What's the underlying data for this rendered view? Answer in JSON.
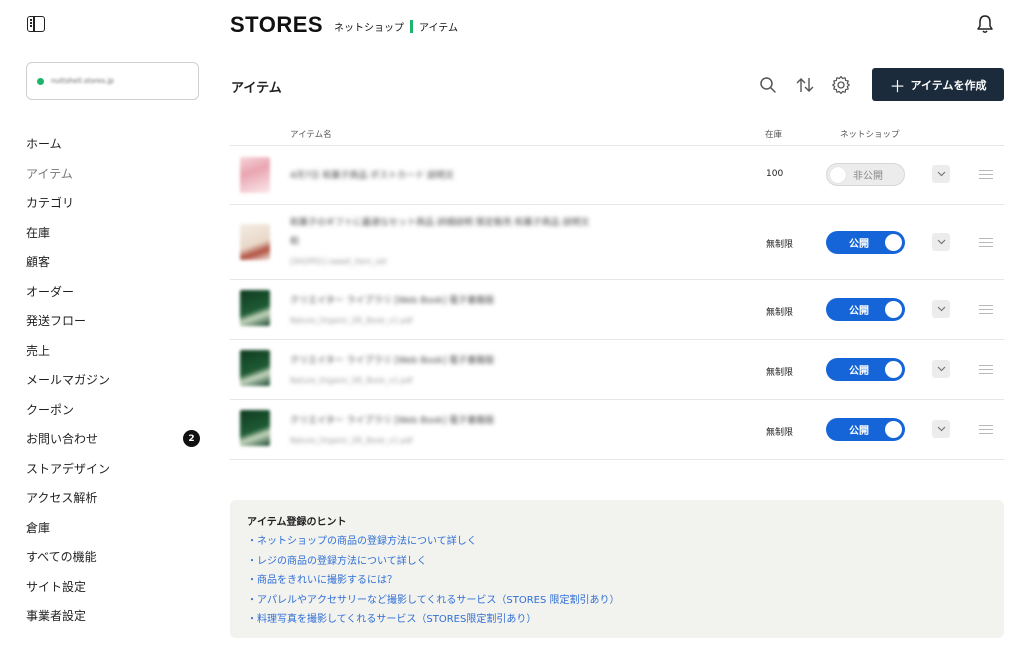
{
  "sidebar": {
    "store_url": "nuttshell.stores.jp",
    "items": [
      {
        "label": "ホーム"
      },
      {
        "label": "アイテム",
        "active": true
      },
      {
        "label": "カテゴリ"
      },
      {
        "label": "在庫"
      },
      {
        "label": "顧客"
      },
      {
        "label": "オーダー"
      },
      {
        "label": "発送フロー"
      },
      {
        "label": "売上"
      },
      {
        "label": "メールマガジン"
      },
      {
        "label": "クーポン"
      },
      {
        "label": "お問い合わせ",
        "badge": "2"
      },
      {
        "label": "ストアデザイン"
      },
      {
        "label": "アクセス解析"
      },
      {
        "label": "倉庫"
      },
      {
        "label": "すべての機能"
      },
      {
        "label": "サイト設定"
      },
      {
        "label": "事業者設定"
      }
    ]
  },
  "header": {
    "logo": "STORES",
    "section": "ネットショップ",
    "page": "アイテム"
  },
  "page": {
    "title": "アイテム",
    "create_button": "アイテムを作成"
  },
  "table": {
    "columns": {
      "name": "アイテム名",
      "stock": "在庫",
      "shop": "ネットショップ"
    },
    "rows": [
      {
        "title": "4月7日 和菓子商品 ポストカード 説明文",
        "subtitle": "",
        "stock": "100",
        "status": "非公開",
        "published": false,
        "thumb": "pink"
      },
      {
        "title": "和菓子のギフトに最適なセット商品 詳細説明 限定販売 和菓子商品 説明文",
        "title2": "和",
        "subtitle": "[SHOP01] sweet_item_set",
        "stock": "無制限",
        "status": "公開",
        "published": true,
        "thumb": "cream"
      },
      {
        "title": "クリエイター ライブラリ [Web Book] 電子書籍版",
        "subtitle": "Nature_Organic_DE_Book_v1.pdf",
        "stock": "無制限",
        "status": "公開",
        "published": true,
        "thumb": "green"
      },
      {
        "title": "クリエイター ライブラリ [Web Book] 電子書籍版",
        "subtitle": "Nature_Organic_DE_Book_v1.pdf",
        "stock": "無制限",
        "status": "公開",
        "published": true,
        "thumb": "green"
      },
      {
        "title": "クリエイター ライブラリ [Web Book] 電子書籍版",
        "subtitle": "Nature_Organic_DE_Book_v1.pdf",
        "stock": "無制限",
        "status": "公開",
        "published": true,
        "thumb": "green"
      }
    ]
  },
  "hints": {
    "title": "アイテム登録のヒント",
    "links": [
      "・ネットショップの商品の登録方法について詳しく",
      "・レジの商品の登録方法について詳しく",
      "・商品をきれいに撮影するには？",
      "・アパレルやアクセサリーなど撮影してくれるサービス（STORES 限定割引あり）",
      "・料理写真を撮影してくれるサービス（STORES限定割引あり）"
    ]
  },
  "colors": {
    "accent": "#1565d8",
    "primary_button": "#1c2b3c",
    "brand_green": "#1db56a",
    "hint_link": "#2f6fd6"
  }
}
